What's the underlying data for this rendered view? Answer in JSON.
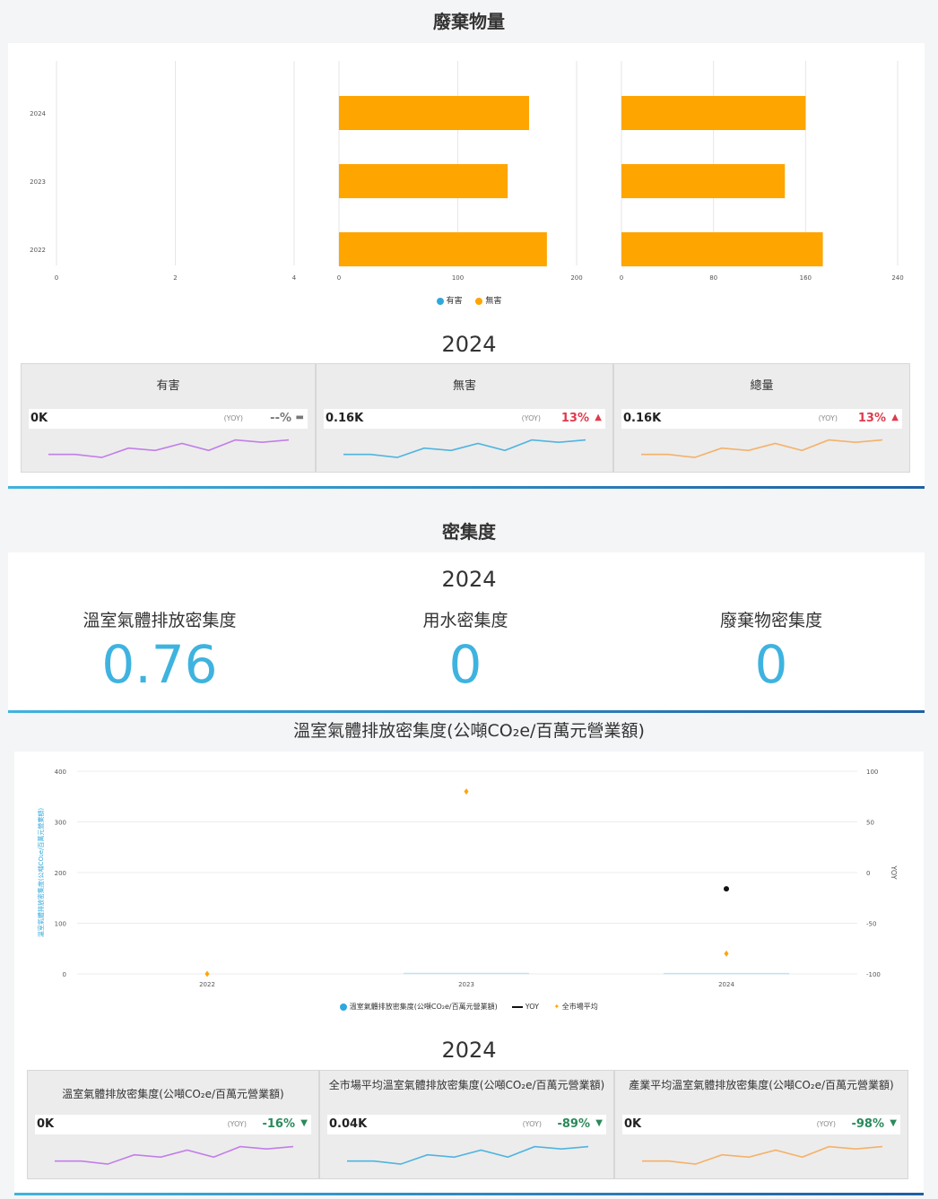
{
  "waste": {
    "title": "廢棄物量",
    "legend": [
      {
        "name": "有害",
        "color": "#2ea8dc"
      },
      {
        "name": "無害",
        "color": "#ffa500"
      }
    ],
    "year": "2024",
    "cards": [
      {
        "title": "有害",
        "value": "0K",
        "yoy_label": "(YOY)",
        "yoy": "--%",
        "arrow": "▬",
        "trend": "flat",
        "line_color": "#c27ee8"
      },
      {
        "title": "無害",
        "value": "0.16K",
        "yoy_label": "(YOY)",
        "yoy": "13%",
        "arrow": "▲",
        "trend": "up",
        "line_color": "#4fb4e0"
      },
      {
        "title": "總量",
        "value": "0.16K",
        "yoy_label": "(YOY)",
        "yoy": "13%",
        "arrow": "▲",
        "trend": "up",
        "line_color": "#f5b169"
      }
    ]
  },
  "density": {
    "title": "密集度",
    "year": "2024",
    "items": [
      {
        "label": "溫室氣體排放密集度",
        "value": "0.76"
      },
      {
        "label": "用水密集度",
        "value": "0"
      },
      {
        "label": "廢棄物密集度",
        "value": "0"
      }
    ]
  },
  "ghg": {
    "title": "溫室氣體排放密集度(公噸CO₂e/百萬元營業額)",
    "y_label": "溫室氣體排放密集度(公噸CO₂e/百萬元營業額)",
    "y2_label": "YOY",
    "legend": [
      {
        "name": "溫室氣體排放密集度(公噸CO₂e/百萬元營業額)",
        "color": "#2ea8dc",
        "marker": "dot"
      },
      {
        "name": "YOY",
        "color": "#111111",
        "marker": "dot-line"
      },
      {
        "name": "全市場平均",
        "color": "#ffa500",
        "marker": "diamond"
      }
    ],
    "year": "2024",
    "cards": [
      {
        "title": "溫室氣體排放密集度(公噸CO₂e/百萬元營業額)",
        "value": "0K",
        "yoy_label": "(YOY)",
        "yoy": "-16%",
        "arrow": "▼",
        "trend": "down",
        "line_color": "#c27ee8"
      },
      {
        "title": "全市場平均溫室氣體排放密集度(公噸CO₂e/百萬元營業額)",
        "value": "0.04K",
        "yoy_label": "(YOY)",
        "yoy": "-89%",
        "arrow": "▼",
        "trend": "down",
        "line_color": "#4fb4e0"
      },
      {
        "title": "產業平均溫室氣體排放密集度(公噸CO₂e/百萬元營業額)",
        "value": "0K",
        "yoy_label": "(YOY)",
        "yoy": "-98%",
        "arrow": "▼",
        "trend": "down",
        "line_color": "#f5b169"
      }
    ]
  },
  "chart_data": [
    {
      "type": "bar",
      "orientation": "horizontal",
      "series_name": "有害",
      "categories": [
        "2024",
        "2023",
        "2022"
      ],
      "values": [
        0,
        0,
        0
      ],
      "xlim": [
        0,
        4
      ],
      "xticks": [
        "0",
        "2",
        "4"
      ]
    },
    {
      "type": "bar",
      "orientation": "horizontal",
      "series_name": "無害",
      "categories": [
        "2024",
        "2023",
        "2022"
      ],
      "values": [
        160,
        142,
        175
      ],
      "xlim": [
        0,
        200
      ],
      "xticks": [
        "0",
        "100",
        "200"
      ],
      "color": "#ffa500"
    },
    {
      "type": "bar",
      "orientation": "horizontal",
      "series_name": "總量",
      "categories": [
        "2024",
        "2023",
        "2022"
      ],
      "values": [
        160,
        142,
        175
      ],
      "xlim": [
        0,
        240
      ],
      "xticks": [
        "0",
        "80",
        "160",
        "240"
      ],
      "color": "#ffa500"
    },
    {
      "type": "scatter",
      "x": [
        "2022",
        "2023",
        "2024"
      ],
      "ylim": [
        0,
        400
      ],
      "yticks": [
        "0",
        "100",
        "200",
        "300",
        "400"
      ],
      "y2lim": [
        -100,
        100
      ],
      "y2ticks": [
        "-100",
        "-50",
        "0",
        "50",
        "100"
      ],
      "series": [
        {
          "name": "溫室氣體排放密集度(公噸CO₂e/百萬元營業額)",
          "axis": "left",
          "values": [
            0,
            0.9,
            0.76
          ],
          "color": "#2ea8dc"
        },
        {
          "name": "YOY",
          "axis": "right",
          "values": [
            null,
            null,
            -16
          ],
          "color": "#111111"
        },
        {
          "name": "全市場平均",
          "axis": "left",
          "values": [
            0,
            360,
            40
          ],
          "color": "#ffa500"
        }
      ]
    }
  ],
  "sparklines": [
    [
      0.72,
      0.72,
      0.85,
      0.45,
      0.55,
      0.25,
      0.55,
      0.1,
      0.2,
      0.1
    ],
    [
      0.72,
      0.72,
      0.85,
      0.45,
      0.55,
      0.25,
      0.55,
      0.1,
      0.2,
      0.1
    ],
    [
      0.72,
      0.72,
      0.85,
      0.45,
      0.55,
      0.25,
      0.55,
      0.1,
      0.2,
      0.1
    ]
  ]
}
